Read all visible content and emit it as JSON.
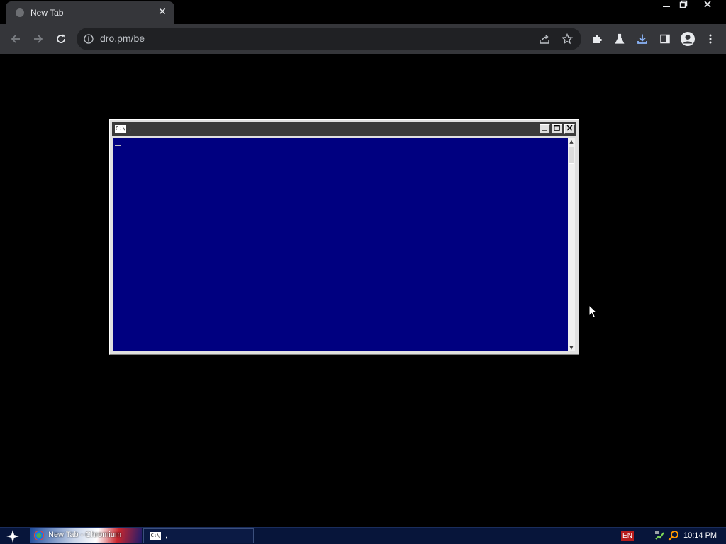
{
  "browser": {
    "tab_title": "New Tab",
    "url": "dro.pm/be"
  },
  "console": {
    "icon_text": "C:\\",
    "title": ","
  },
  "taskbar": {
    "items": [
      {
        "label": "New Tab - Chromium"
      },
      {
        "label": ",",
        "icon_text": "C:\\"
      }
    ],
    "language": "EN",
    "clock": "10:14 PM"
  },
  "colors": {
    "console_background": "#000080",
    "download_accent": "#8ab4f8",
    "taskbar": "#07153a"
  },
  "icons": [
    "globe-icon",
    "close-icon",
    "minimize-icon",
    "restore-icon",
    "back-icon",
    "forward-icon",
    "reload-icon",
    "info-icon",
    "share-icon",
    "star-icon",
    "extensions-icon",
    "labs-flask-icon",
    "download-icon",
    "side-panel-icon",
    "profile-icon",
    "menu-icon",
    "start-icon",
    "chromium-icon",
    "console-icon",
    "network-icon",
    "search-icon",
    "mouse-pointer-icon"
  ]
}
